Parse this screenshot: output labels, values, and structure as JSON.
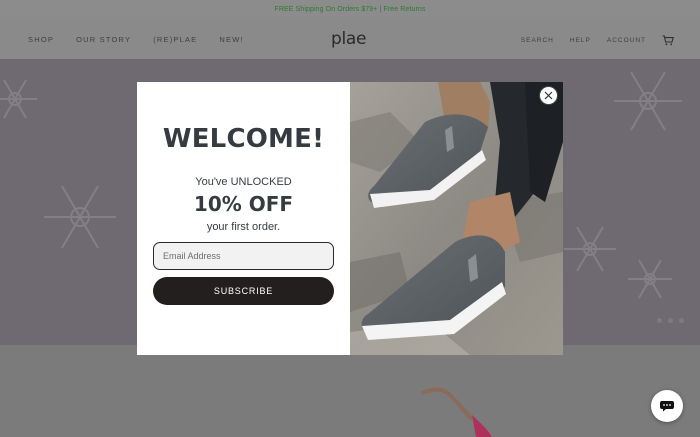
{
  "announcement": "FREE Shipping On Orders $79+ | Free Returns",
  "brand": {
    "logo": "plae"
  },
  "nav_left": [
    "SHOP",
    "OUR STORY",
    "(RE)PLAE",
    "NEW!"
  ],
  "nav_right": [
    "SEARCH",
    "HELP",
    "ACCOUNT"
  ],
  "icons": {
    "cart": "cart-icon",
    "close": "close-icon",
    "chat": "chat-icon"
  },
  "modal": {
    "heading": "WELCOME!",
    "line1": "You've UNLOCKED",
    "offer": "10% OFF",
    "line2": "your first order.",
    "email_placeholder": "Email Address",
    "email_value": "",
    "subscribe_label": "SUBSCRIBE"
  },
  "colors": {
    "announcement_text": "#2f7a2f",
    "heading": "#353b40",
    "button_bg": "#231f1e",
    "overlay_bg": "#7a7a7a"
  }
}
